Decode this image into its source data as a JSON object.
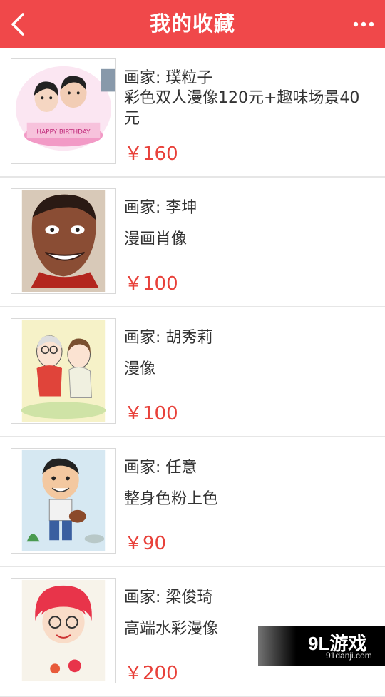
{
  "header": {
    "title": "我的收藏",
    "back_icon": "chevron-left-icon",
    "more_icon": "more-dots-icon",
    "color": "#f0484a"
  },
  "items": [
    {
      "artist": "画家: 璞粒子",
      "title": "彩色双人漫像120元+趣味场景40元",
      "price": "￥160",
      "thumb": "couple-cake-caricature"
    },
    {
      "artist": "画家: 李坤",
      "title": "漫画肖像",
      "price": "￥100",
      "thumb": "male-caricature-portrait"
    },
    {
      "artist": "画家: 胡秀莉",
      "title": "漫像",
      "price": "￥100",
      "thumb": "couple-garden-caricature"
    },
    {
      "artist": "画家: 任意",
      "title": "整身色粉上色",
      "price": "￥90",
      "thumb": "boy-fullbody-caricature"
    },
    {
      "artist": "画家: 梁俊琦",
      "title": "高端水彩漫像",
      "price": "￥200",
      "thumb": "girl-watercolor-caricature"
    }
  ],
  "watermark": {
    "logo": "9L游戏",
    "url": "91danji.com"
  },
  "price_color": "#e8413a"
}
